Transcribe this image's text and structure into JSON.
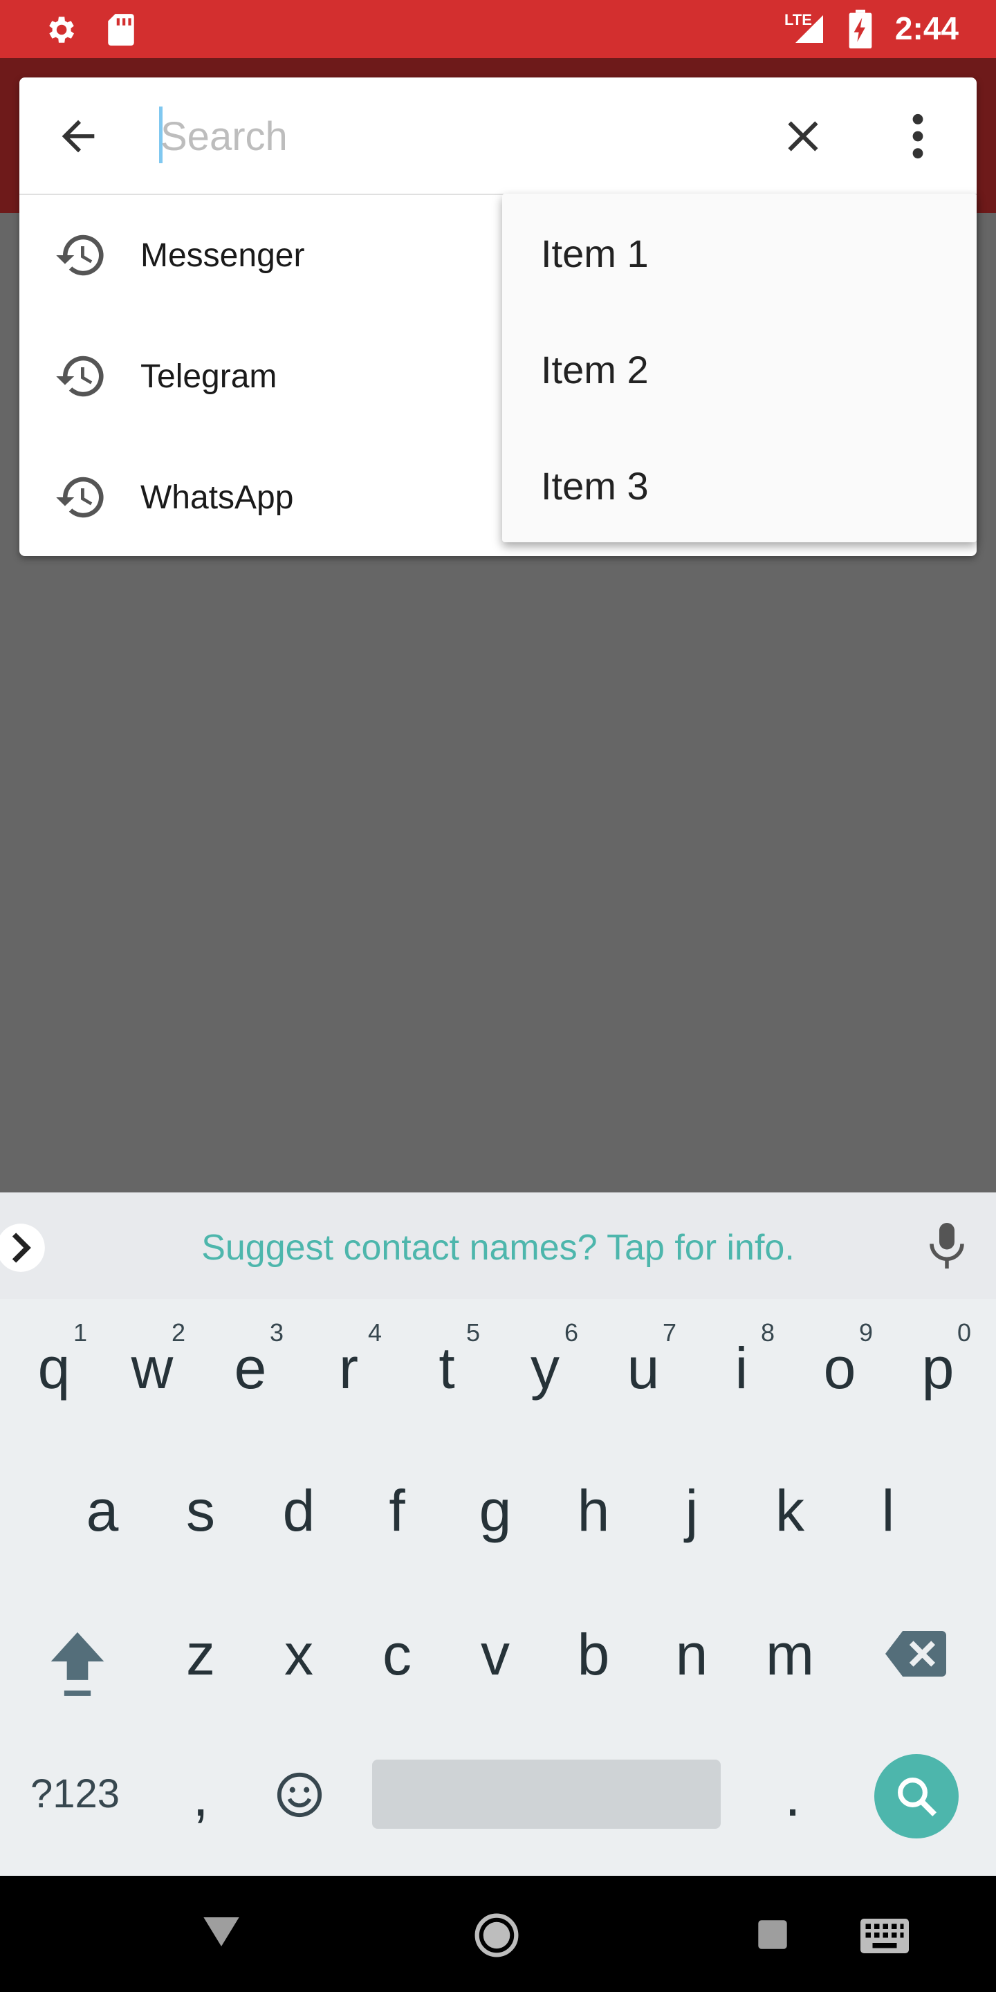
{
  "status_bar": {
    "time": "2:44",
    "network": "LTE",
    "icons": [
      "settings-gear-icon",
      "sd-card-icon",
      "lte-signal-icon",
      "battery-charging-icon"
    ]
  },
  "search": {
    "placeholder": "Search",
    "value": "",
    "back_icon": "arrow-back-icon",
    "clear_icon": "close-icon",
    "more_icon": "more-vert-icon"
  },
  "suggestions": [
    {
      "label": "Messenger",
      "icon": "history-icon"
    },
    {
      "label": "Telegram",
      "icon": "history-icon"
    },
    {
      "label": "WhatsApp",
      "icon": "history-icon"
    }
  ],
  "menu": {
    "items": [
      "Item 1",
      "Item 2",
      "Item 3"
    ]
  },
  "keyboard": {
    "suggestion_text": "Suggest contact names? Tap for info.",
    "row1": [
      {
        "key": "q",
        "hint": "1"
      },
      {
        "key": "w",
        "hint": "2"
      },
      {
        "key": "e",
        "hint": "3"
      },
      {
        "key": "r",
        "hint": "4"
      },
      {
        "key": "t",
        "hint": "5"
      },
      {
        "key": "y",
        "hint": "6"
      },
      {
        "key": "u",
        "hint": "7"
      },
      {
        "key": "i",
        "hint": "8"
      },
      {
        "key": "o",
        "hint": "9"
      },
      {
        "key": "p",
        "hint": "0"
      }
    ],
    "row2": [
      "a",
      "s",
      "d",
      "f",
      "g",
      "h",
      "j",
      "k",
      "l"
    ],
    "row3": [
      "z",
      "x",
      "c",
      "v",
      "b",
      "n",
      "m"
    ],
    "symbols_label": "?123",
    "comma": ",",
    "period": ".",
    "accent_color": "#4DB6AC"
  },
  "colors": {
    "status_bar": "#D32F2F",
    "app_bar": "#6E1A1A",
    "scrim": "#666666"
  }
}
